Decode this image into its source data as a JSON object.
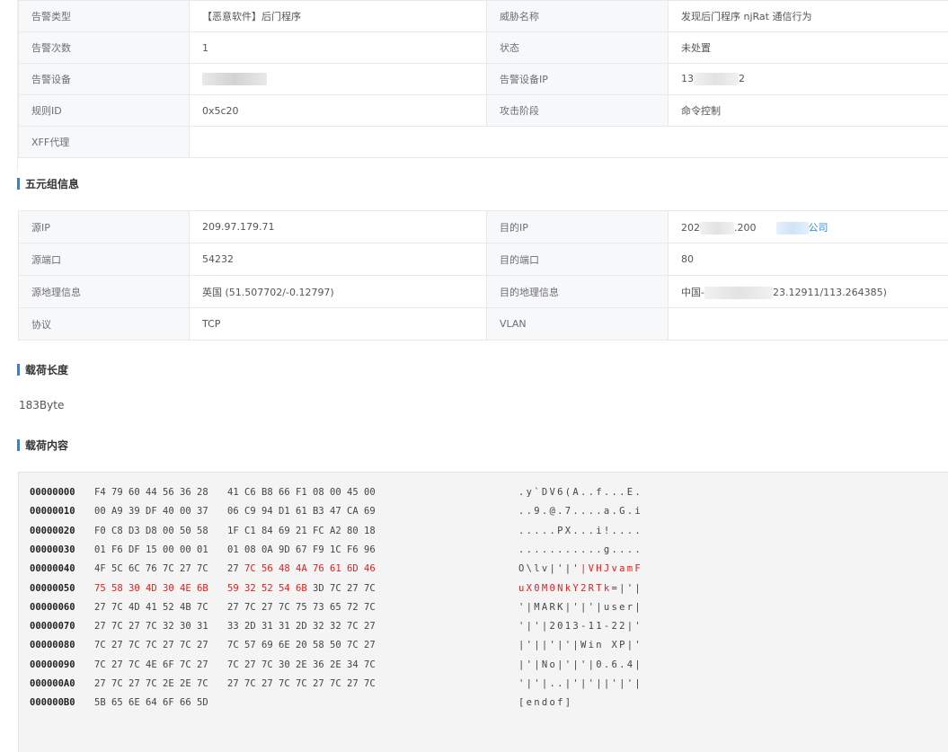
{
  "alert_info": {
    "rows": [
      {
        "l1": "告警类型",
        "v1": "【恶意软件】后门程序",
        "l2": "威胁名称",
        "v2": "发现后门程序 njRat 通信行为"
      },
      {
        "l1": "告警次数",
        "v1": "1",
        "l2": "状态",
        "v2": "未处置"
      },
      {
        "l1": "告警设备",
        "v1": "",
        "l2": "告警设备IP",
        "v2_prefix": "13",
        "v2_suffix": "2"
      },
      {
        "l1": "规则ID",
        "v1": "0x5c20",
        "l2": "攻击阶段",
        "v2": "命令控制"
      },
      {
        "l1": "XFF代理",
        "v1": "",
        "l2": "",
        "v2": ""
      }
    ]
  },
  "tuple_section": {
    "title": "五元组信息",
    "rows": [
      {
        "l1": "源IP",
        "v1": "209.97.179.71",
        "l2": "目的IP",
        "v2_prefix": "202",
        "v2_suffix": ".200",
        "v2_link": "公司"
      },
      {
        "l1": "源端口",
        "v1": "54232",
        "l2": "目的端口",
        "v2": "80"
      },
      {
        "l1": "源地理信息",
        "v1": "英国 (51.507702/-0.12797)",
        "l2": "目的地理信息",
        "v2_prefix": "中国-",
        "v2_suffix": "23.12911/113.264385)"
      },
      {
        "l1": "协议",
        "v1": "TCP",
        "l2": "VLAN",
        "v2": ""
      }
    ]
  },
  "payload_length": {
    "title": "载荷长度",
    "value": "183Byte"
  },
  "payload_content": {
    "title": "载荷内容",
    "highlight_color": "#e02020",
    "rows": [
      {
        "offset": "00000000",
        "bytes": [
          "F4",
          "79",
          "60",
          "44",
          "56",
          "36",
          "28",
          "41",
          "C6",
          "B8",
          "66",
          "F1",
          "08",
          "00",
          "45",
          "00"
        ],
        "hl": [],
        "ascii": ".y`DV6(A..f...E."
      },
      {
        "offset": "00000010",
        "bytes": [
          "00",
          "A9",
          "39",
          "DF",
          "40",
          "00",
          "37",
          "06",
          "C9",
          "94",
          "D1",
          "61",
          "B3",
          "47",
          "CA",
          "69"
        ],
        "hl": [],
        "ascii": "..9.@.7....a.G.i"
      },
      {
        "offset": "00000020",
        "bytes": [
          "F0",
          "C8",
          "D3",
          "D8",
          "00",
          "50",
          "58",
          "1F",
          "C1",
          "84",
          "69",
          "21",
          "FC",
          "A2",
          "80",
          "18"
        ],
        "hl": [],
        "ascii": ".....PX...i!...."
      },
      {
        "offset": "00000030",
        "bytes": [
          "01",
          "F6",
          "DF",
          "15",
          "00",
          "00",
          "01",
          "01",
          "08",
          "0A",
          "9D",
          "67",
          "F9",
          "1C",
          "F6",
          "96"
        ],
        "hl": [],
        "ascii": "...........g...."
      },
      {
        "offset": "00000040",
        "bytes": [
          "4F",
          "5C",
          "6C",
          "76",
          "7C",
          "27",
          "7C",
          "27",
          "7C",
          "56",
          "48",
          "4A",
          "76",
          "61",
          "6D",
          "46"
        ],
        "hl": [
          8,
          9,
          10,
          11,
          12,
          13,
          14,
          15
        ],
        "ascii": "O\\lv|'|'|VHJvamF"
      },
      {
        "offset": "00000050",
        "bytes": [
          "75",
          "58",
          "30",
          "4D",
          "30",
          "4E",
          "6B",
          "59",
          "32",
          "52",
          "54",
          "6B",
          "3D",
          "7C",
          "27",
          "7C"
        ],
        "hl": [
          0,
          1,
          2,
          3,
          4,
          5,
          6,
          7,
          8,
          9,
          10,
          11
        ],
        "ascii": "uX0M0NkY2RTk=|'|"
      },
      {
        "offset": "00000060",
        "bytes": [
          "27",
          "7C",
          "4D",
          "41",
          "52",
          "4B",
          "7C",
          "27",
          "7C",
          "27",
          "7C",
          "75",
          "73",
          "65",
          "72",
          "7C"
        ],
        "hl": [],
        "ascii": "'|MARK|'|'|user|"
      },
      {
        "offset": "00000070",
        "bytes": [
          "27",
          "7C",
          "27",
          "7C",
          "32",
          "30",
          "31",
          "33",
          "2D",
          "31",
          "31",
          "2D",
          "32",
          "32",
          "7C",
          "27"
        ],
        "hl": [],
        "ascii": "'|'|2013-11-22|'"
      },
      {
        "offset": "00000080",
        "bytes": [
          "7C",
          "27",
          "7C",
          "7C",
          "27",
          "7C",
          "27",
          "7C",
          "57",
          "69",
          "6E",
          "20",
          "58",
          "50",
          "7C",
          "27"
        ],
        "hl": [],
        "ascii": "|'||'|'|Win XP|'"
      },
      {
        "offset": "00000090",
        "bytes": [
          "7C",
          "27",
          "7C",
          "4E",
          "6F",
          "7C",
          "27",
          "7C",
          "27",
          "7C",
          "30",
          "2E",
          "36",
          "2E",
          "34",
          "7C"
        ],
        "hl": [],
        "ascii": "|'|No|'|'|0.6.4|"
      },
      {
        "offset": "000000A0",
        "bytes": [
          "27",
          "7C",
          "27",
          "7C",
          "2E",
          "2E",
          "7C",
          "27",
          "7C",
          "27",
          "7C",
          "7C",
          "27",
          "7C",
          "27",
          "7C"
        ],
        "hl": [],
        "ascii": "'|'|..|'|'||'|'|"
      },
      {
        "offset": "000000B0",
        "bytes": [
          "5B",
          "65",
          "6E",
          "64",
          "6F",
          "66",
          "5D"
        ],
        "hl": [],
        "ascii": "[endof]"
      }
    ]
  }
}
